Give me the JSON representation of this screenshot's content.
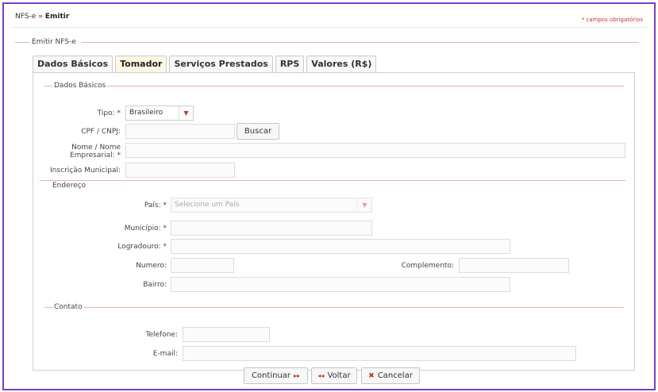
{
  "breadcrumb": {
    "root": "NFS-e",
    "separator": "»",
    "current": "Emitir"
  },
  "required_note": "* campos obrigatórios",
  "outer_legend": "Emitir NFS-e",
  "tabs": [
    {
      "label": "Dados Básicos"
    },
    {
      "label": "Tomador"
    },
    {
      "label": "Serviços Prestados"
    },
    {
      "label": "RPS"
    },
    {
      "label": "Valores (R$)"
    }
  ],
  "active_tab": "Tomador",
  "dados_basicos": {
    "legend": "Dados Básicos",
    "tipo_label": "Tipo:",
    "tipo_req": "*",
    "tipo_value": "Brasileiro",
    "cpf_label": "CPF / CNPJ:",
    "cpf_value": "",
    "buscar_label": "Buscar",
    "nome_label_1": "Nome / Nome",
    "nome_label_2": "Empresarial: *",
    "nome_value": "",
    "inscricao_label": "Inscrição Municipal:",
    "inscricao_value": ""
  },
  "endereco": {
    "legend": "Endereço",
    "pais_label": "País:",
    "pais_req": "*",
    "pais_placeholder": "Selecione um País",
    "municipio_label": "Município: *",
    "logradouro_label": "Logradouro:",
    "logradouro_req": "*",
    "numero_label": "Numero:",
    "complemento_label": "Complemento:",
    "bairro_label": "Bairro:"
  },
  "contato": {
    "legend": "Contato",
    "telefone_label": "Telefone:",
    "email_label": "E-mail:"
  },
  "actions": {
    "continuar_label": "Continuar",
    "continuar_icon": "double-arrow-right-icon",
    "voltar_label": "Voltar",
    "voltar_icon": "double-arrow-left-icon",
    "cancelar_label": "Cancelar",
    "cancelar_icon": "x-icon"
  },
  "colors": {
    "accent": "#c0392b",
    "frame": "#7a3fc0",
    "active_tab_bg": "#fdf7e3"
  }
}
